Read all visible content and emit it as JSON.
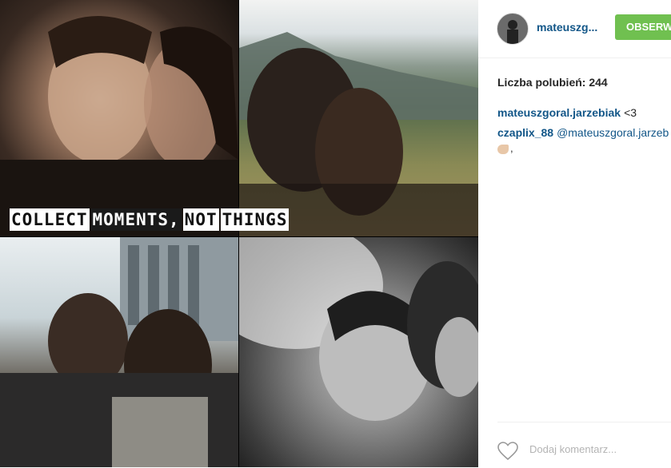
{
  "post": {
    "caption_words": [
      "COLLECT",
      "MOMENTS,",
      "NOT",
      "THINGS"
    ]
  },
  "header": {
    "username": "mateuszg...",
    "follow_label": "OBSERW"
  },
  "likes": {
    "text": "Liczba polubień: 244"
  },
  "comments": [
    {
      "user": "mateuszgoral.jarzebiak",
      "text": "<3"
    },
    {
      "user": "czaplix_88",
      "text": "@mateuszgoral.jarzeb"
    }
  ],
  "emoji_line": {
    "icon": "flexed-biceps-emoji",
    "text": ","
  },
  "footer": {
    "placeholder": "Dodaj komentarz..."
  },
  "colors": {
    "link": "#125688",
    "follow_button": "#70c050"
  }
}
